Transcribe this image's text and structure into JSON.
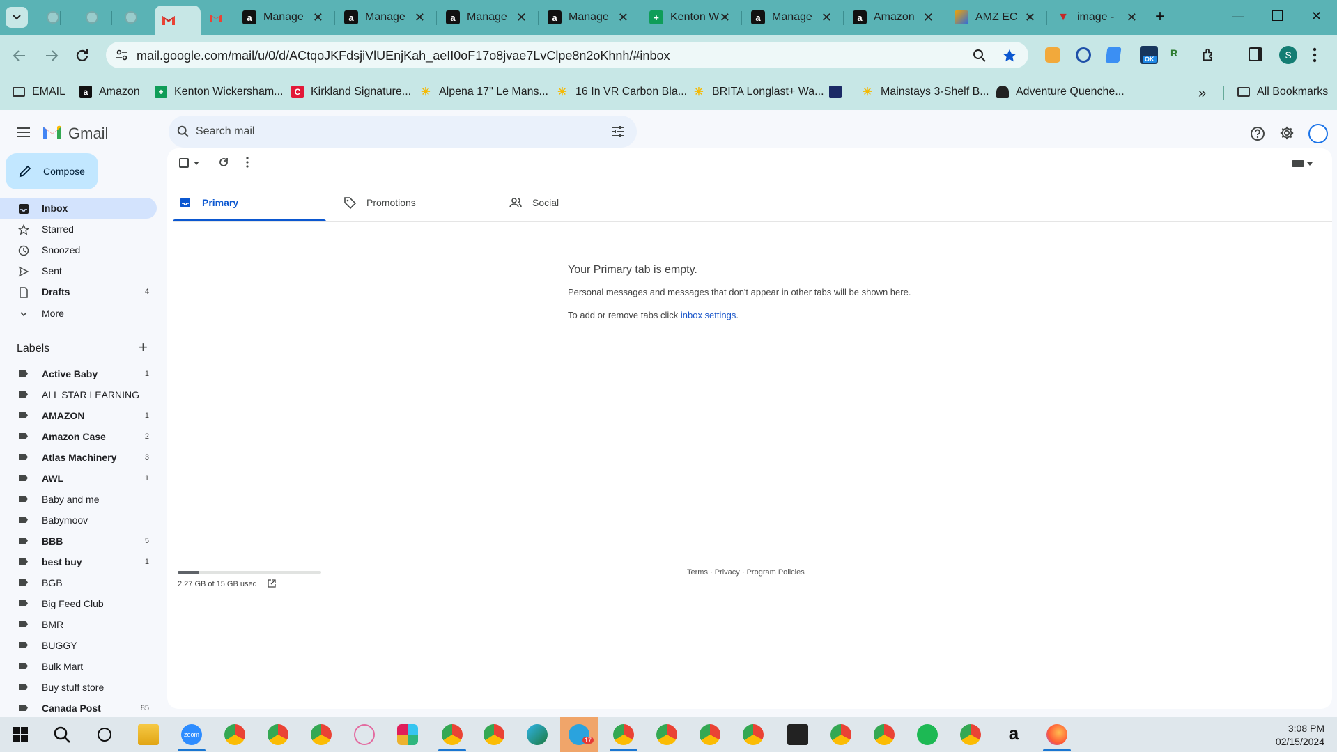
{
  "browser": {
    "tabs": [
      {
        "title": "",
        "icon": "blank"
      },
      {
        "title": "",
        "icon": "blank"
      },
      {
        "title": "",
        "icon": "blank"
      },
      {
        "title": "",
        "icon": "gmail",
        "active": true
      },
      {
        "title": "",
        "icon": "gmail"
      },
      {
        "title": "Manage",
        "icon": "amazon"
      },
      {
        "title": "Manage",
        "icon": "amazon"
      },
      {
        "title": "Manage",
        "icon": "amazon"
      },
      {
        "title": "Manage",
        "icon": "amazon"
      },
      {
        "title": "Kenton W",
        "icon": "sheets"
      },
      {
        "title": "Manage",
        "icon": "amazon"
      },
      {
        "title": "Amazon",
        "icon": "amazon"
      },
      {
        "title": "AMZ EC",
        "icon": "app"
      },
      {
        "title": "image -",
        "icon": "vivaldi"
      }
    ],
    "url": "mail.google.com/mail/u/0/d/ACtqoJKFdsjiVlUEnjKah_aeII0oF17o8jvae7LvClpe8n2oKhnh/#inbox",
    "bookmarks": [
      {
        "label": "EMAIL",
        "icon": "folder"
      },
      {
        "label": "Amazon",
        "icon": "amazon"
      },
      {
        "label": "Kenton Wickersham...",
        "icon": "sheets"
      },
      {
        "label": "Kirkland Signature...",
        "icon": "costco"
      },
      {
        "label": "Alpena 17\" Le Mans...",
        "icon": "walmart"
      },
      {
        "label": "16 In VR Carbon Bla...",
        "icon": "walmart"
      },
      {
        "label": "BRITA Longlast+ Wa...",
        "icon": "walmart"
      },
      {
        "label": "",
        "icon": "app"
      },
      {
        "label": "Mainstays 3-Shelf B...",
        "icon": "walmart"
      },
      {
        "label": "Adventure Quenche...",
        "icon": "app"
      }
    ],
    "all_bookmarks": "All Bookmarks",
    "profile_initial": "S",
    "ext_badge": "OK"
  },
  "gmail": {
    "logo_text": "Gmail",
    "search_placeholder": "Search mail",
    "compose": "Compose",
    "nav": [
      {
        "label": "Inbox",
        "count": "",
        "icon": "inbox-icon",
        "active": true
      },
      {
        "label": "Starred",
        "count": "",
        "icon": "star-icon"
      },
      {
        "label": "Snoozed",
        "count": "",
        "icon": "clock-icon"
      },
      {
        "label": "Sent",
        "count": "",
        "icon": "send-icon"
      },
      {
        "label": "Drafts",
        "count": "4",
        "icon": "draft-icon"
      },
      {
        "label": "More",
        "count": "",
        "icon": "chevron-down-icon"
      }
    ],
    "labels_heading": "Labels",
    "labels": [
      {
        "name": "Active Baby",
        "count": "1",
        "bold": true
      },
      {
        "name": "ALL STAR LEARNING",
        "count": "",
        "bold": false
      },
      {
        "name": "AMAZON",
        "count": "1",
        "bold": true
      },
      {
        "name": "Amazon Case",
        "count": "2",
        "bold": true
      },
      {
        "name": "Atlas Machinery",
        "count": "3",
        "bold": true
      },
      {
        "name": "AWL",
        "count": "1",
        "bold": true
      },
      {
        "name": "Baby and me",
        "count": "",
        "bold": false
      },
      {
        "name": "Babymoov",
        "count": "",
        "bold": false
      },
      {
        "name": "BBB",
        "count": "5",
        "bold": true
      },
      {
        "name": "best buy",
        "count": "1",
        "bold": true
      },
      {
        "name": "BGB",
        "count": "",
        "bold": false
      },
      {
        "name": "Big Feed Club",
        "count": "",
        "bold": false
      },
      {
        "name": "BMR",
        "count": "",
        "bold": false
      },
      {
        "name": "BUGGY",
        "count": "",
        "bold": false
      },
      {
        "name": "Bulk Mart",
        "count": "",
        "bold": false
      },
      {
        "name": "Buy stuff store",
        "count": "",
        "bold": false
      },
      {
        "name": "Canada Post",
        "count": "85",
        "bold": true
      }
    ],
    "tabs": [
      {
        "label": "Primary",
        "icon": "inbox-icon",
        "active": true
      },
      {
        "label": "Promotions",
        "icon": "tag-icon"
      },
      {
        "label": "Social",
        "icon": "people-icon"
      }
    ],
    "empty_title": "Your Primary tab is empty.",
    "empty_line1": "Personal messages and messages that don't appear in other tabs will be shown here.",
    "empty_line2_prefix": "To add or remove tabs click ",
    "empty_line2_link": "inbox settings",
    "storage_used_fraction": 0.151,
    "storage_text": "2.27 GB of 15 GB used",
    "footer_terms": "Terms",
    "footer_privacy": "Privacy",
    "footer_policies": "Program Policies"
  },
  "taskbar": {
    "time": "3:08 PM",
    "date": "02/15/2024",
    "telegram_badge": "17",
    "zoom_label": "zoom"
  },
  "colors": {
    "accent_blue": "#0b57d0",
    "compose_bg": "#c2e7ff",
    "nav_active": "#d3e3fd",
    "tab_strip": "#5ab3b5",
    "toolbar": "#c7e7e6"
  }
}
